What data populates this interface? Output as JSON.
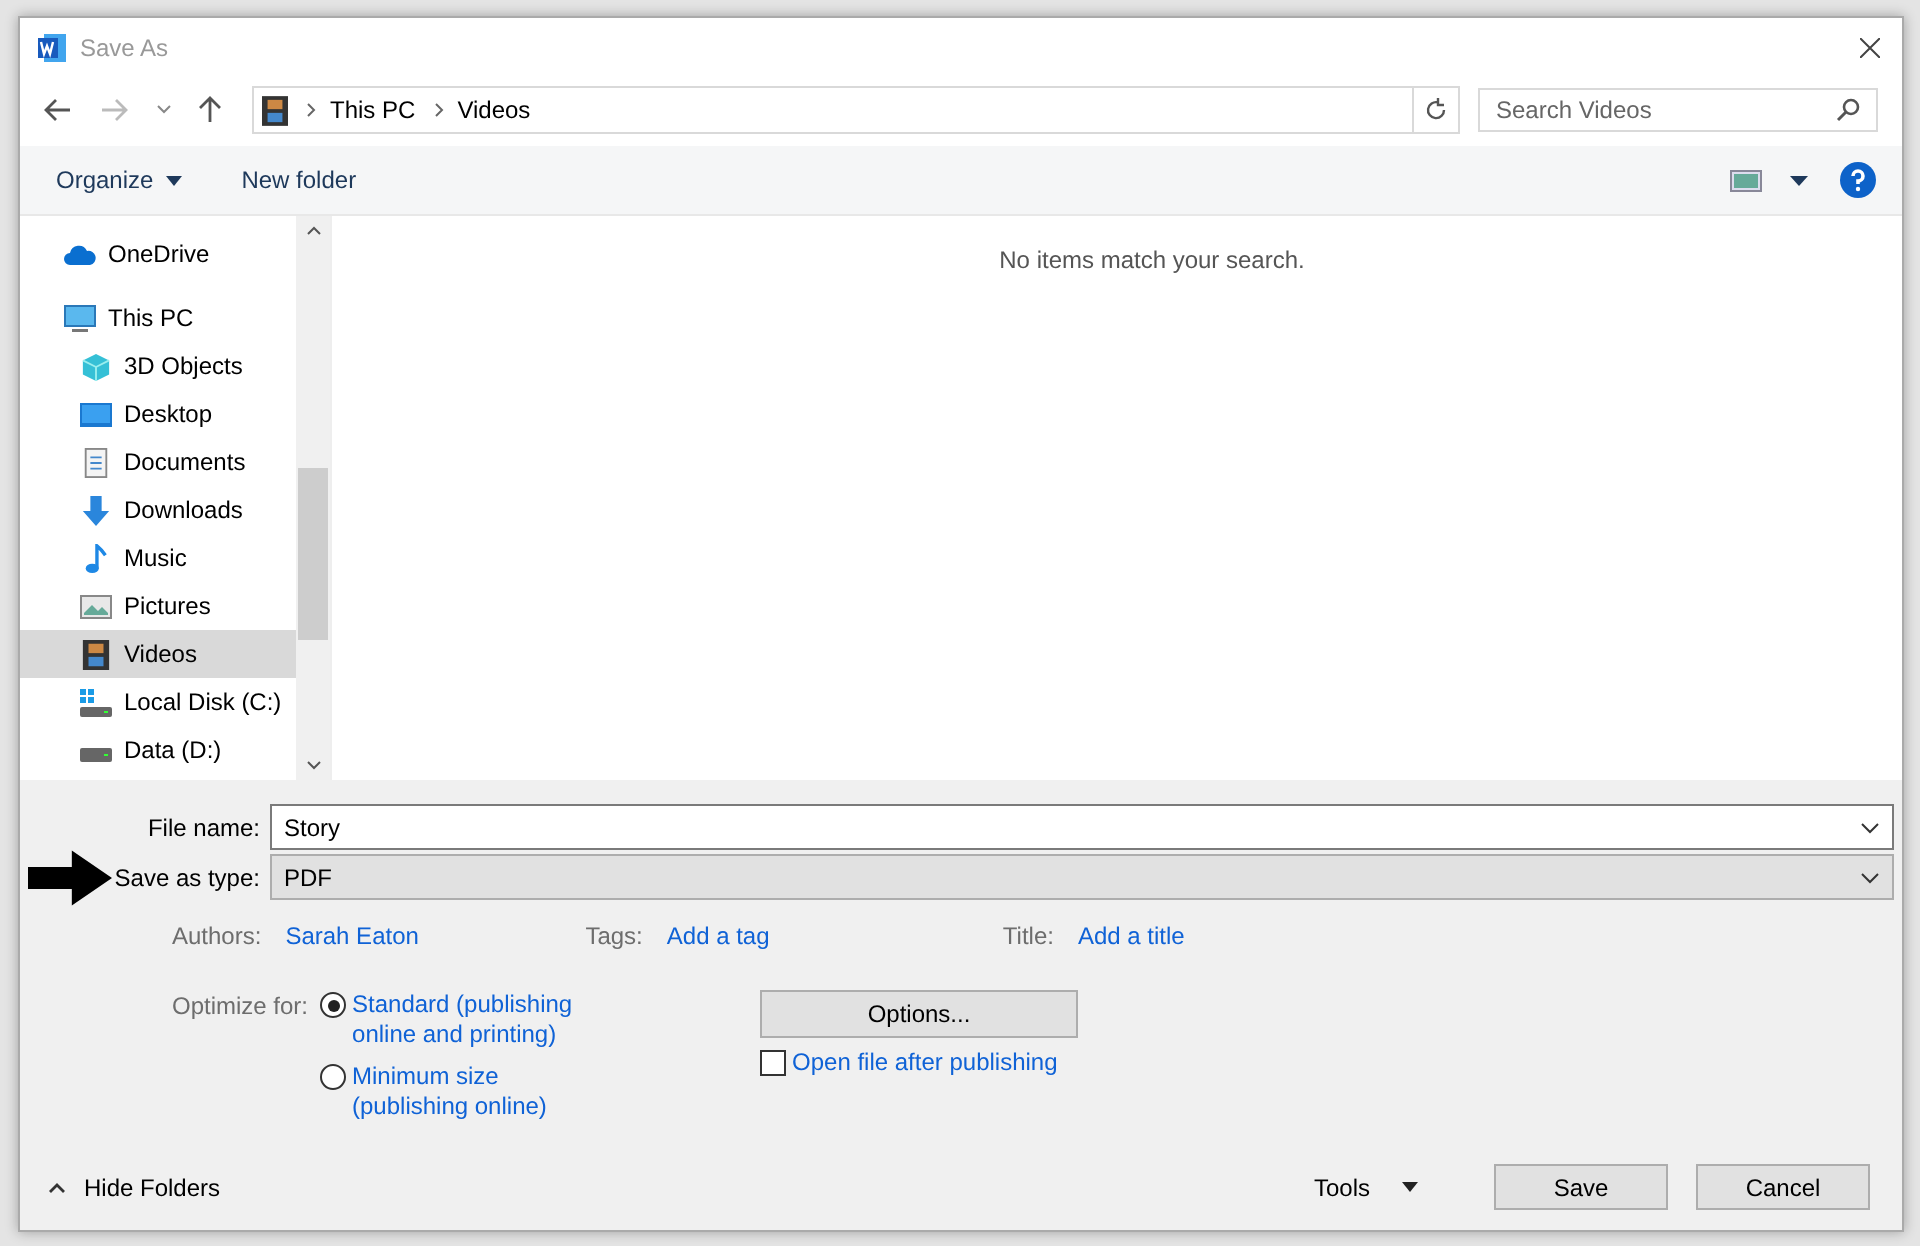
{
  "window": {
    "title": "Save As"
  },
  "address": {
    "crumbs": [
      "This PC",
      "Videos"
    ],
    "search_placeholder": "Search Videos"
  },
  "toolbar": {
    "organize": "Organize",
    "new_folder": "New folder"
  },
  "sidebar": {
    "items": [
      {
        "label": "OneDrive",
        "kind": "cloud",
        "selected": false
      },
      {
        "label": "This PC",
        "kind": "pc",
        "selected": false,
        "children": [
          {
            "label": "3D Objects",
            "kind": "cube",
            "selected": false
          },
          {
            "label": "Desktop",
            "kind": "desktop",
            "selected": false
          },
          {
            "label": "Documents",
            "kind": "doc",
            "selected": false
          },
          {
            "label": "Downloads",
            "kind": "download",
            "selected": false
          },
          {
            "label": "Music",
            "kind": "music",
            "selected": false
          },
          {
            "label": "Pictures",
            "kind": "pictures",
            "selected": false
          },
          {
            "label": "Videos",
            "kind": "video",
            "selected": true
          },
          {
            "label": "Local Disk (C:)",
            "kind": "disk_c",
            "selected": false
          },
          {
            "label": "Data (D:)",
            "kind": "disk",
            "selected": false
          }
        ]
      }
    ]
  },
  "content": {
    "empty_message": "No items match your search."
  },
  "form": {
    "file_name_label": "File name:",
    "file_name": "Story",
    "type_label": "Save as type:",
    "type": "PDF",
    "authors_label": "Authors:",
    "authors": "Sarah Eaton",
    "tags_label": "Tags:",
    "tags": "Add a tag",
    "title_label": "Title:",
    "title": "Add a title",
    "optimize_label": "Optimize for:",
    "optimize_options": [
      {
        "label": "Standard (publishing online and printing)",
        "selected": true
      },
      {
        "label": "Minimum size (publishing online)",
        "selected": false
      }
    ],
    "options_button": "Options...",
    "open_after": {
      "label": "Open file after publishing",
      "checked": false
    }
  },
  "footer": {
    "hide_folders": "Hide Folders",
    "tools": "Tools",
    "save": "Save",
    "cancel": "Cancel"
  }
}
